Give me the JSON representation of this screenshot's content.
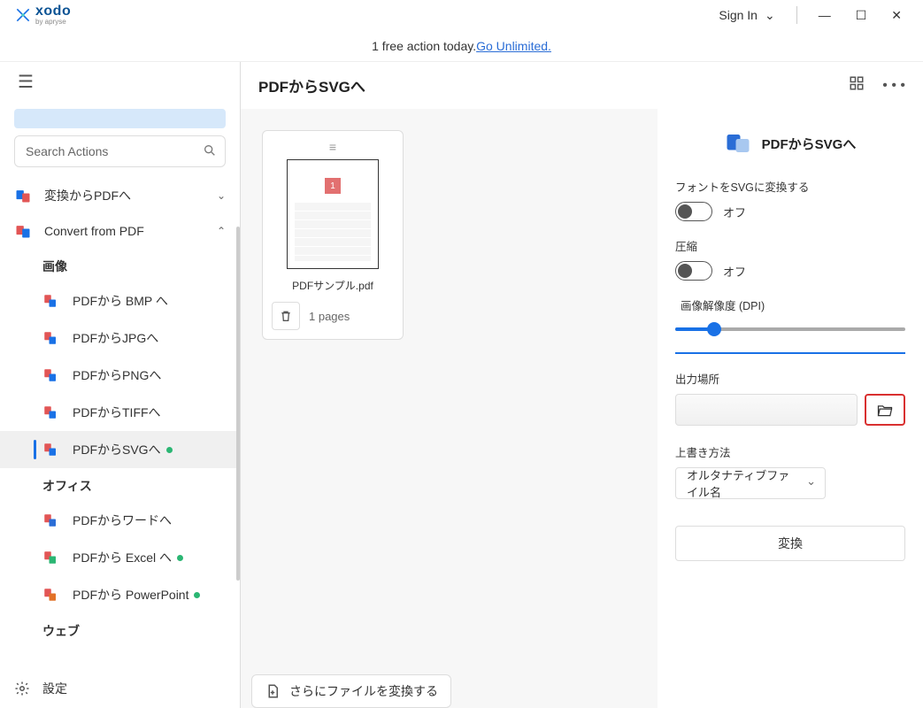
{
  "brand": {
    "name": "xodo",
    "sub": "by apryse"
  },
  "titlebar": {
    "signin": "Sign In"
  },
  "banner": {
    "text": "1 free action today. ",
    "link": "Go Unlimited."
  },
  "sidebar": {
    "search_placeholder": "Search Actions",
    "group_convert_to": "変換からPDFへ",
    "group_convert_from": "Convert from PDF",
    "section_image": "画像",
    "items_image": [
      {
        "label": "PDFから BMP へ"
      },
      {
        "label": "PDFからJPGへ"
      },
      {
        "label": "PDFからPNGへ"
      },
      {
        "label": "PDFからTIFFへ"
      },
      {
        "label": "PDFからSVGへ",
        "dot": true,
        "selected": true
      }
    ],
    "section_office": "オフィス",
    "items_office": [
      {
        "label": "PDFからワードへ"
      },
      {
        "label": "PDFから Excel へ",
        "dot": true
      },
      {
        "label": "PDFから PowerPoint",
        "dot": true
      }
    ],
    "section_web": "ウェブ",
    "settings": "設定"
  },
  "main": {
    "title": "PDFからSVGへ",
    "file_name": "PDFサンプル.pdf",
    "pages": "1 pages",
    "add_more": "さらにファイルを変換する"
  },
  "options": {
    "header": "PDFからSVGへ",
    "font_svg": "フォントをSVGに変換する",
    "off": "オフ",
    "compress": "圧縮",
    "dpi": "画像解像度 (DPI)",
    "output": "出力場所",
    "overwrite": "上書き方法",
    "overwrite_value": "オルタナティブファイル名",
    "convert": "変換"
  }
}
